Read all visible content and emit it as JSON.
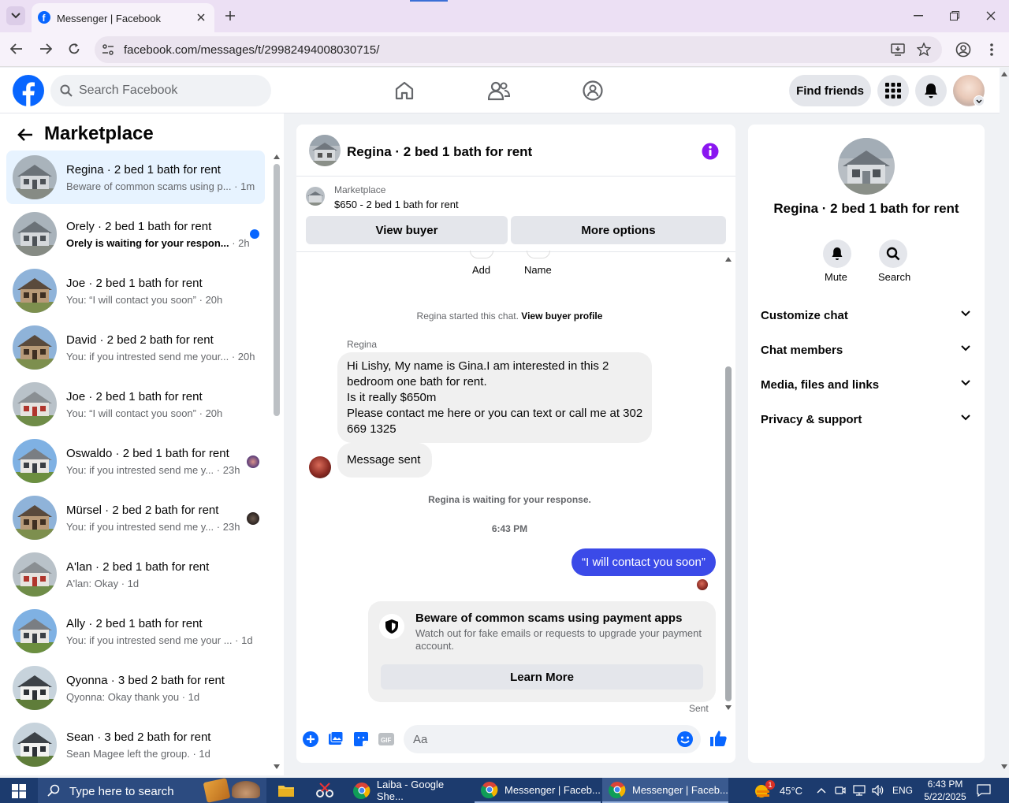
{
  "browser": {
    "tab_title": "Messenger | Facebook",
    "url": "facebook.com/messages/t/29982494008030715/"
  },
  "fb": {
    "search_placeholder": "Search Facebook",
    "find_friends": "Find friends"
  },
  "sidebar": {
    "title": "Marketplace",
    "items": [
      {
        "title": "Regina · 2 bed 1 bath for rent",
        "preview": "Beware of common scams using p...",
        "time": "· 1m",
        "active": true,
        "house": "gray"
      },
      {
        "title": "Orely · 2 bed 1 bath for rent",
        "preview": "Orely is waiting for your respon...",
        "time": "· 2h",
        "unread": true,
        "house": "gray"
      },
      {
        "title": "Joe · 2 bed 1 bath for rent",
        "preview": "You: “I will contact you soon”",
        "time": "· 20h",
        "house": "brown"
      },
      {
        "title": "David · 2 bed 2 bath for rent",
        "preview": "You: if you intrested send me your...",
        "time": "· 20h",
        "house": "brown"
      },
      {
        "title": "Joe · 2 bed 1 bath for rent",
        "preview": "You: “I will contact you soon”",
        "time": "· 20h",
        "house": "red"
      },
      {
        "title": "Oswaldo · 2 bed 1 bath for rent",
        "preview": "You: if you intrested send me y...",
        "time": "· 23h",
        "house": "blue"
      },
      {
        "title": "Mürsel · 2 bed 2 bath for rent",
        "preview": "You: if you intrested send me y...",
        "time": "· 23h",
        "house": "brown"
      },
      {
        "title": "A'lan · 2 bed 1 bath for rent",
        "preview": "A'lan: Okay",
        "time": "· 1d",
        "house": "red"
      },
      {
        "title": "Ally · 2 bed 1 bath for rent",
        "preview": "You: if you intrested send me your ...",
        "time": "· 1d",
        "house": "blue"
      },
      {
        "title": "Qyonna · 3 bed 2 bath for rent",
        "preview": "Qyonna: Okay thank you",
        "time": "· 1d",
        "house": "white"
      },
      {
        "title": "Sean · 3 bed 2 bath for rent",
        "preview": "Sean Magee left the group.",
        "time": "· 1d",
        "house": "white"
      }
    ]
  },
  "chat": {
    "title": "Regina · 2 bed 1 bath for rent",
    "listing_label": "Marketplace",
    "listing_price": "$650 - 2 bed 1 bath for rent",
    "view_buyer": "View buyer",
    "more_options": "More options",
    "add_label": "Add",
    "name_label": "Name",
    "started_text": "Regina started this chat.",
    "view_buyer_profile": "View buyer profile",
    "sender_name": "Regina",
    "message_lines": [
      "Hi Lishy, My name is Gina.I am interested in this 2",
      "bedroom one bath for rent.",
      "Is it really $650m",
      "Please contact me here or you can text or call me at 302",
      "669 1325"
    ],
    "message_sent": "Message sent",
    "waiting_text": "Regina is waiting for your response.",
    "time_stamp": "6:43 PM",
    "my_message": "“I will contact you soon”",
    "scam_title": "Beware of common scams using payment apps",
    "scam_body": "Watch out for fake emails or requests to upgrade your payment account.",
    "learn_more": "Learn More",
    "sent_status": "Sent",
    "composer_placeholder": "Aa"
  },
  "info": {
    "title": "Regina · 2 bed 1 bath for rent",
    "mute": "Mute",
    "search": "Search",
    "sections": [
      "Customize chat",
      "Chat members",
      "Media, files and links",
      "Privacy & support"
    ]
  },
  "taskbar": {
    "search_placeholder": "Type here to search",
    "apps": [
      "Laiba - Google She...",
      "Messenger | Faceb...",
      "Messenger | Faceb..."
    ],
    "weather": "45°C",
    "weather_badge": "1",
    "language": "ENG",
    "time": "6:43 PM",
    "date": "5/22/2025"
  },
  "colors": {
    "fb_blue": "#0866ff",
    "messenger_blue": "#3b4ae8",
    "info_purple": "#8a16f0"
  }
}
